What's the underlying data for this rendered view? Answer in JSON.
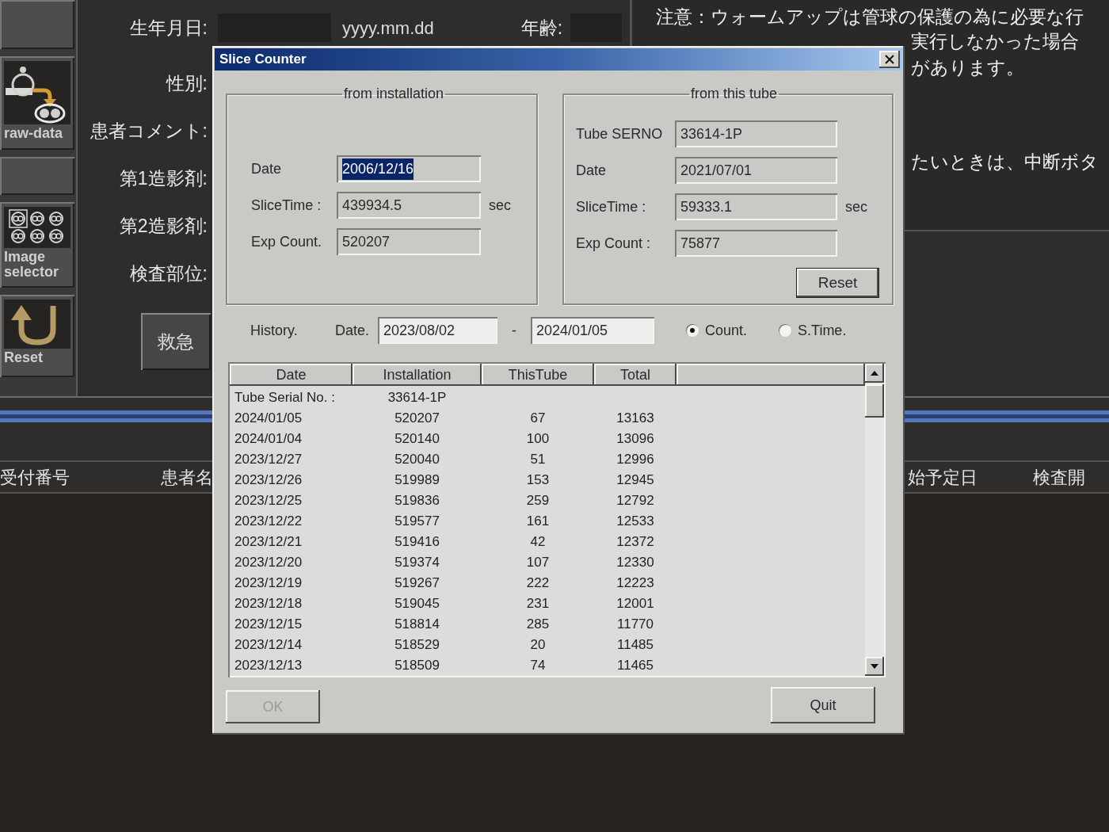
{
  "sidebar": {
    "buttons": [
      {
        "kind": "blank"
      },
      {
        "kind": "raw_data",
        "label": "raw-data"
      },
      {
        "kind": "blank"
      },
      {
        "kind": "image_selector",
        "label": "Image selector"
      },
      {
        "kind": "reset",
        "label": "Reset"
      }
    ]
  },
  "patient_form": {
    "labels": [
      "生年月日:",
      "性別:",
      "患者コメント:",
      "第1造影剤:",
      "第2造影剤:",
      "検査部位:"
    ],
    "birth_date_format": "yyyy.mm.dd",
    "age_label": "年齢:",
    "emergency_button": "救急"
  },
  "notice": {
    "first_line": "注意：ウォームアップは管球の保護の為に必要な行",
    "fragments": [
      "実行しなかった場合",
      "があります。",
      "たいときは、中断ボタ"
    ]
  },
  "exam_list": {
    "columns": [
      "受付番号",
      "患者名",
      "始予定日",
      "検査開"
    ]
  },
  "dialog": {
    "title": "Slice Counter",
    "installation": {
      "title": "from installation",
      "fields": [
        {
          "label": "Date",
          "value": "2006/12/16",
          "highlighted": true
        },
        {
          "label": "SliceTime :",
          "value": "439934.5",
          "unit": "sec",
          "highlighted": false
        },
        {
          "label": "Exp Count.",
          "value": "520207",
          "highlighted": false
        }
      ]
    },
    "tube": {
      "title": "from this tube",
      "fields": [
        {
          "label": "Tube SERNO",
          "value": "33614-1P",
          "highlighted": false
        },
        {
          "label": "Date",
          "value": "2021/07/01",
          "highlighted": false
        },
        {
          "label": "SliceTime :",
          "value": "59333.1",
          "unit": "sec",
          "highlighted": false
        },
        {
          "label": "Exp Count :",
          "value": "75877",
          "highlighted": false
        }
      ],
      "reset_button": "Reset"
    },
    "history": {
      "label": "History.",
      "date_label": "Date.",
      "from": "2023/08/02",
      "separator": "-",
      "to": "2024/01/05",
      "modes": [
        {
          "label": "Count.",
          "selected": true
        },
        {
          "label": "S.Time.",
          "selected": false
        }
      ]
    },
    "table": {
      "columns": [
        "Date",
        "Installation",
        "ThisTube",
        "Total"
      ],
      "serial_row": {
        "label": "Tube Serial No. :",
        "value": "33614-1P"
      },
      "rows": [
        {
          "date": "2024/01/05",
          "installation": "520207",
          "this_tube": "67",
          "total": "13163"
        },
        {
          "date": "2024/01/04",
          "installation": "520140",
          "this_tube": "100",
          "total": "13096"
        },
        {
          "date": "2023/12/27",
          "installation": "520040",
          "this_tube": "51",
          "total": "12996"
        },
        {
          "date": "2023/12/26",
          "installation": "519989",
          "this_tube": "153",
          "total": "12945"
        },
        {
          "date": "2023/12/25",
          "installation": "519836",
          "this_tube": "259",
          "total": "12792"
        },
        {
          "date": "2023/12/22",
          "installation": "519577",
          "this_tube": "161",
          "total": "12533"
        },
        {
          "date": "2023/12/21",
          "installation": "519416",
          "this_tube": "42",
          "total": "12372"
        },
        {
          "date": "2023/12/20",
          "installation": "519374",
          "this_tube": "107",
          "total": "12330"
        },
        {
          "date": "2023/12/19",
          "installation": "519267",
          "this_tube": "222",
          "total": "12223"
        },
        {
          "date": "2023/12/18",
          "installation": "519045",
          "this_tube": "231",
          "total": "12001"
        },
        {
          "date": "2023/12/15",
          "installation": "518814",
          "this_tube": "285",
          "total": "11770"
        },
        {
          "date": "2023/12/14",
          "installation": "518529",
          "this_tube": "20",
          "total": "11485"
        },
        {
          "date": "2023/12/13",
          "installation": "518509",
          "this_tube": "74",
          "total": "11465"
        }
      ]
    },
    "buttons": [
      {
        "label": "OK",
        "disabled": true
      },
      {
        "label": "Quit",
        "disabled": false
      }
    ]
  }
}
